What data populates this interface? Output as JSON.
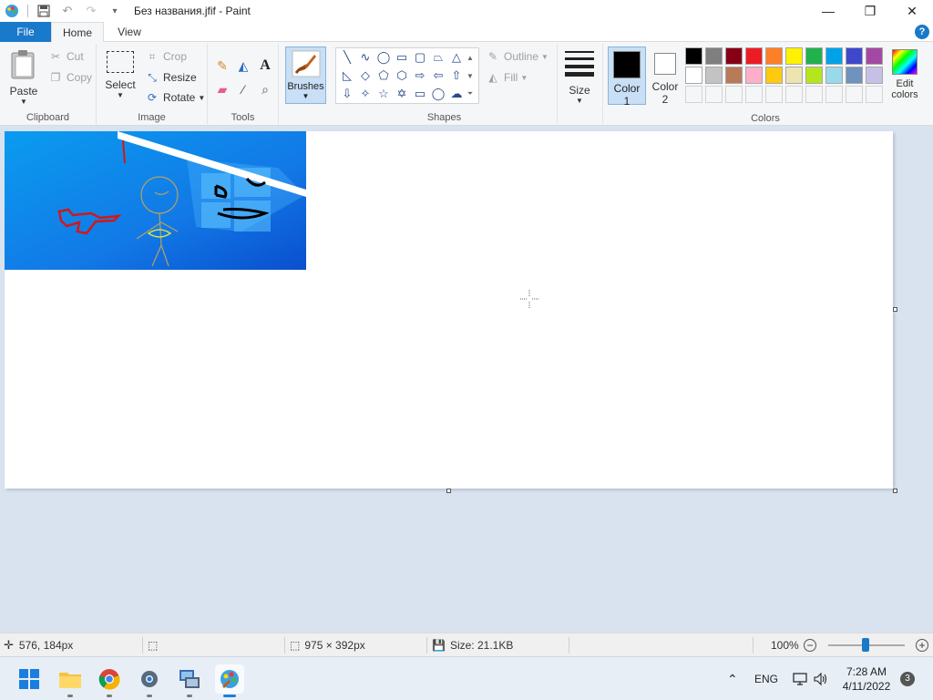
{
  "titlebar": {
    "title": "Без названия.jfif - Paint",
    "minimize": "—",
    "maximize": "❐",
    "close": "✕"
  },
  "tabs": {
    "file": "File",
    "home": "Home",
    "view": "View",
    "help": "?"
  },
  "clipboard": {
    "paste": "Paste",
    "cut": "Cut",
    "copy": "Copy",
    "label": "Clipboard"
  },
  "image": {
    "select": "Select",
    "crop": "Crop",
    "resize": "Resize",
    "rotate": "Rotate",
    "label": "Image"
  },
  "tools": {
    "label": "Tools"
  },
  "brushes": {
    "label": "Brushes"
  },
  "shapes": {
    "outline": "Outline",
    "fill": "Fill",
    "label": "Shapes"
  },
  "size": {
    "label": "Size"
  },
  "colors": {
    "color1_line1": "Color",
    "color1_line2": "1",
    "color2_line1": "Color",
    "color2_line2": "2",
    "edit_line1": "Edit",
    "edit_line2": "colors",
    "label": "Colors",
    "color1": "#000000",
    "color2": "#ffffff",
    "palette_row1": [
      "#000000",
      "#7f7f7f",
      "#880015",
      "#ed1c24",
      "#ff7f27",
      "#fff200",
      "#22b14c",
      "#00a2e8",
      "#3f48cc",
      "#a349a4"
    ],
    "palette_row2": [
      "#ffffff",
      "#c3c3c3",
      "#b97a57",
      "#ffaec9",
      "#ffc90e",
      "#efe4b0",
      "#b5e61d",
      "#99d9ea",
      "#7092be",
      "#c8bfe7"
    ]
  },
  "status": {
    "cursor_pos": "576, 184px",
    "canvas_size": "975 × 392px",
    "file_size": "Size: 21.1KB",
    "zoom": "100%",
    "zoom_level": 0.5
  },
  "taskbar": {
    "lang": "ENG",
    "time": "7:28 AM",
    "date": "4/11/2022",
    "notifications": "3"
  }
}
